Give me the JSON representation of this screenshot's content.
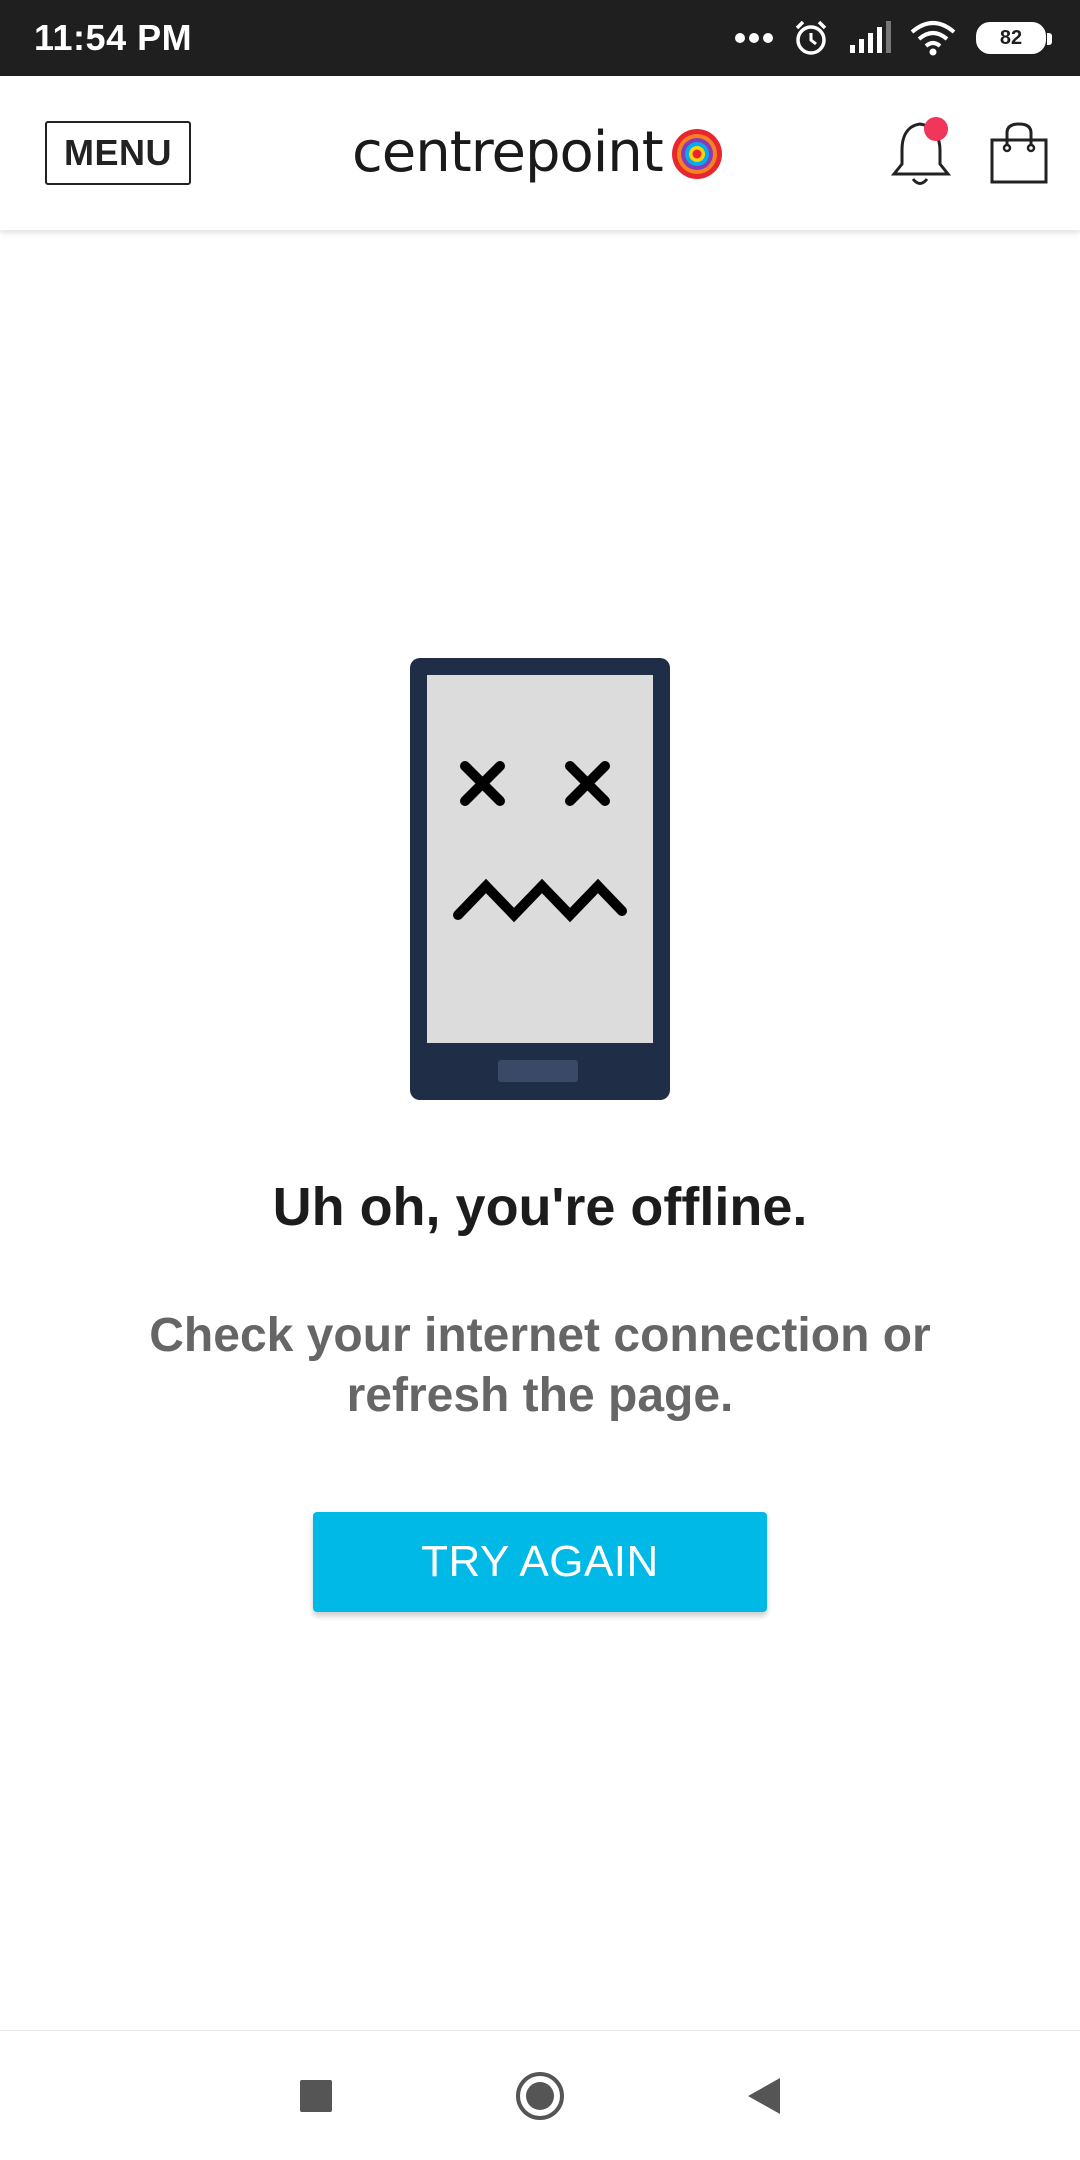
{
  "status_bar": {
    "time": "11:54 PM",
    "battery": "82",
    "icons": [
      "more-dots-icon",
      "alarm-icon",
      "signal-icon",
      "wifi-icon",
      "battery-icon"
    ]
  },
  "header": {
    "menu_label": "MENU",
    "logo_text": "centrepoint",
    "icons": [
      "notification-bell-icon",
      "shopping-bag-icon"
    ],
    "notification_dot_color": "#f0365a"
  },
  "offline": {
    "headline": "Uh oh, you're offline.",
    "message": "Check your internet connection or refresh the page.",
    "button_label": "TRY AGAIN",
    "button_color": "#00b9e6",
    "illustration": "sad-phone-icon"
  },
  "nav_bar": {
    "icons": [
      "recents-square-icon",
      "home-circle-icon",
      "back-triangle-icon"
    ]
  }
}
